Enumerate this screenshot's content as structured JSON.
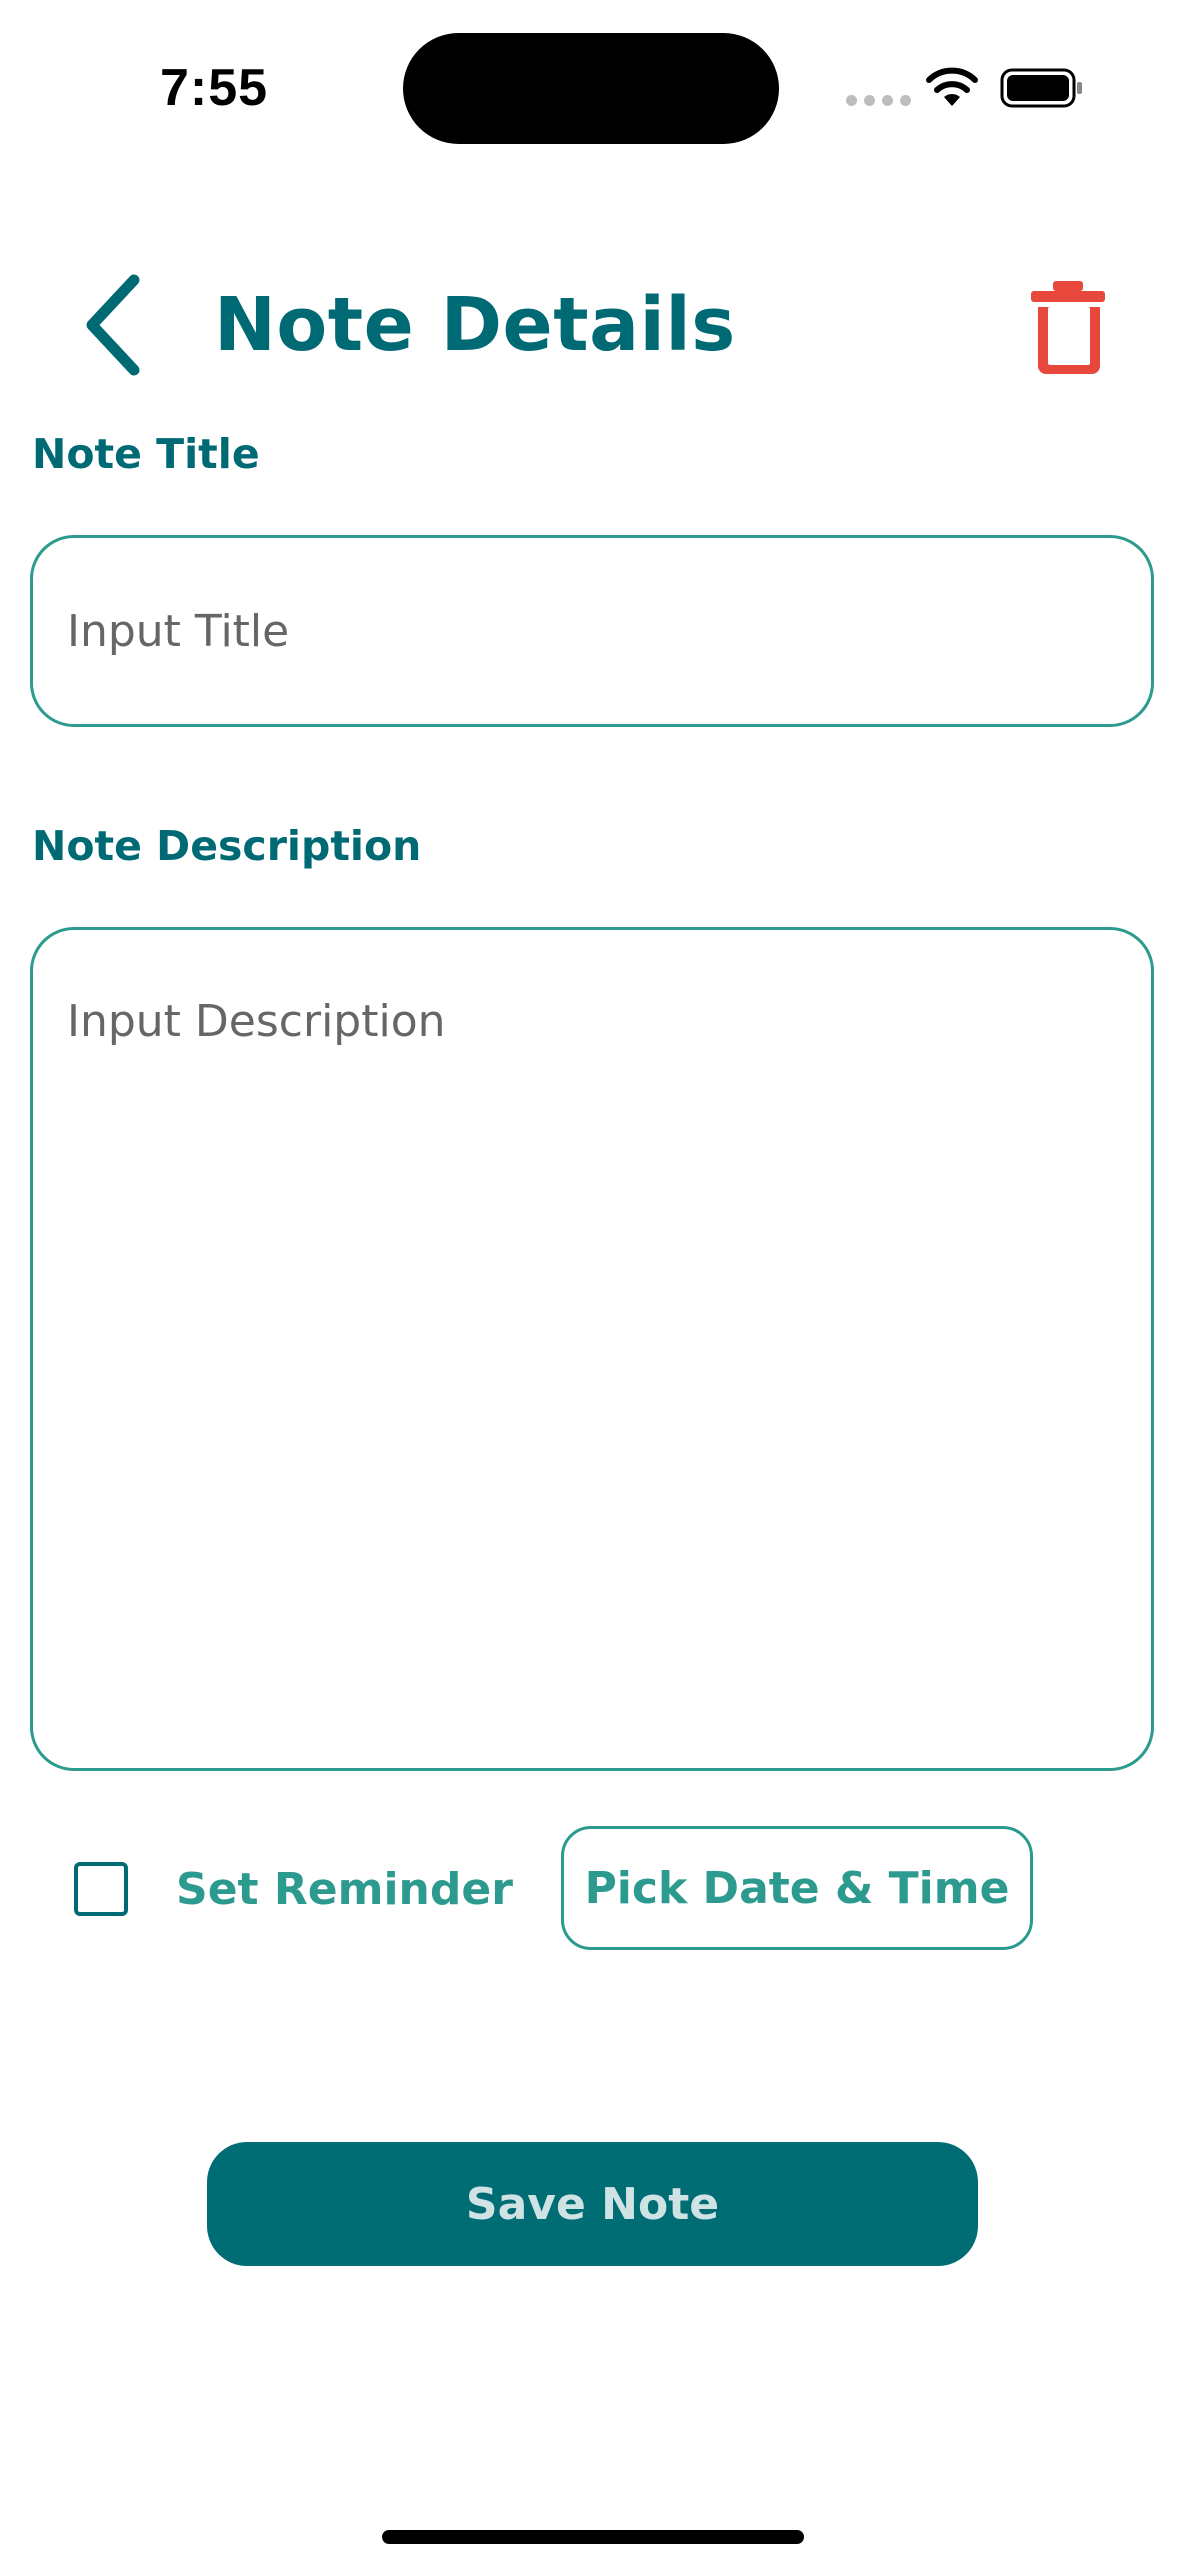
{
  "status_bar": {
    "time": "7:55"
  },
  "header": {
    "title": "Note Details",
    "back_icon": "chevron-left-icon",
    "delete_icon": "trash-icon"
  },
  "form": {
    "title_label": "Note Title",
    "title_value": "",
    "title_placeholder": "Input Title",
    "description_label": "Note Description",
    "description_value": "",
    "description_placeholder": "Input Description"
  },
  "reminder": {
    "checked": false,
    "label": "Set Reminder",
    "pick_button_label": "Pick Date & Time"
  },
  "actions": {
    "save_label": "Save Note"
  },
  "colors": {
    "primary": "#006a74",
    "accent": "#2c9a8e",
    "danger": "#e8473b",
    "button_text": "#cfe3e4"
  }
}
